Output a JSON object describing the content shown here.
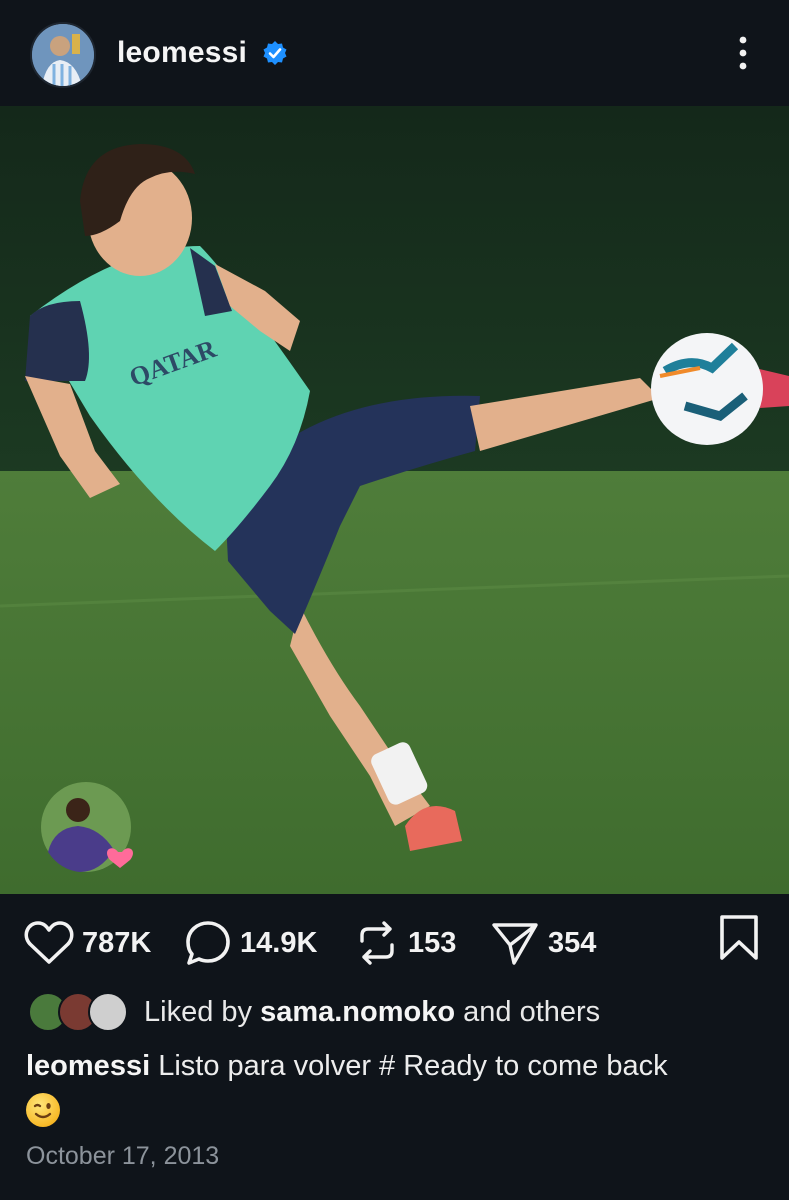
{
  "post": {
    "username": "leomessi",
    "verified": true,
    "more_icon": "more-vertical-icon"
  },
  "photo": {
    "jersey_sponsor": "QATAR AIRWAYS",
    "tagged_reaction": "heart"
  },
  "actions": {
    "likes": "787K",
    "comments": "14.9K",
    "reposts": "153",
    "shares": "354"
  },
  "liked_by": {
    "prefix": "Liked by ",
    "user": "sama.nomoko",
    "suffix": " and others"
  },
  "caption": {
    "username": "leomessi",
    "text": "Listo para volver # Ready to come back",
    "emoji": "😉"
  },
  "date": "October 17, 2013",
  "colors": {
    "background": "#0f141a",
    "verified": "#1e90ff",
    "heart": "#ff6b9a"
  }
}
